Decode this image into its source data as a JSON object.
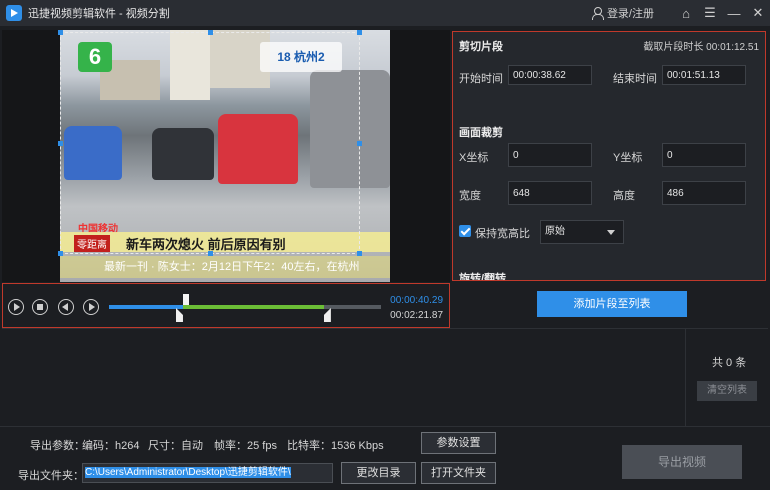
{
  "titlebar": {
    "title": "迅捷视频剪辑软件 - 视频分割",
    "login": "登录/注册",
    "home_icon": "⌂",
    "menu_icon": "☰",
    "minimize_icon": "—",
    "close_icon": "✕"
  },
  "video": {
    "channel_logo": "6",
    "channel_badge": "18 杭州2",
    "caption_small": "中国移动",
    "caption_tag": "零距离",
    "caption_main": "新车两次熄火 前后原因有别",
    "ticker": "最新一刊 · 陈女士：2月12日下午2：40左右，在杭州"
  },
  "playback": {
    "current_time": "00:00:40.29",
    "total_time": "00:02:21.87",
    "played_fraction": 0.284,
    "segment_start_fraction": 0.272,
    "segment_end_fraction": 0.79
  },
  "settings": {
    "clip_section": "剪切片段",
    "duration_label": "截取片段时长",
    "duration_value": "00:01:12.51",
    "start_label": "开始时间",
    "start_value": "00:00:38.62",
    "end_label": "结束时间",
    "end_value": "00:01:51.13",
    "crop_section": "画面裁剪",
    "x_label": "X坐标",
    "x_value": "0",
    "y_label": "Y坐标",
    "y_value": "0",
    "width_label": "宽度",
    "width_value": "648",
    "height_label": "高度",
    "height_value": "486",
    "keep_ratio_label": "保持宽高比",
    "keep_ratio_checked": true,
    "ratio_option": "原始",
    "rotate_section": "旋转/翻转"
  },
  "actions": {
    "add_segment": "添加片段至列表"
  },
  "list": {
    "count": "共 0 条",
    "clear": "清空列表"
  },
  "export": {
    "params_label": "导出参数：",
    "codec": "编码：h264",
    "size": "尺寸：自动",
    "fps": "帧率：25 fps",
    "bitrate": "比特率：1536 Kbps",
    "params_button": "参数设置",
    "folder_label": "导出文件夹：",
    "folder_path": "C:\\Users\\Administrator\\Desktop\\迅捷剪辑软件\\",
    "change_dir": "更改目录",
    "open_folder": "打开文件夹",
    "export_button": "导出视频"
  },
  "colors": {
    "accent": "#2f8fe8",
    "segment": "#6bbd36",
    "highlight_border": "#c0392b"
  }
}
